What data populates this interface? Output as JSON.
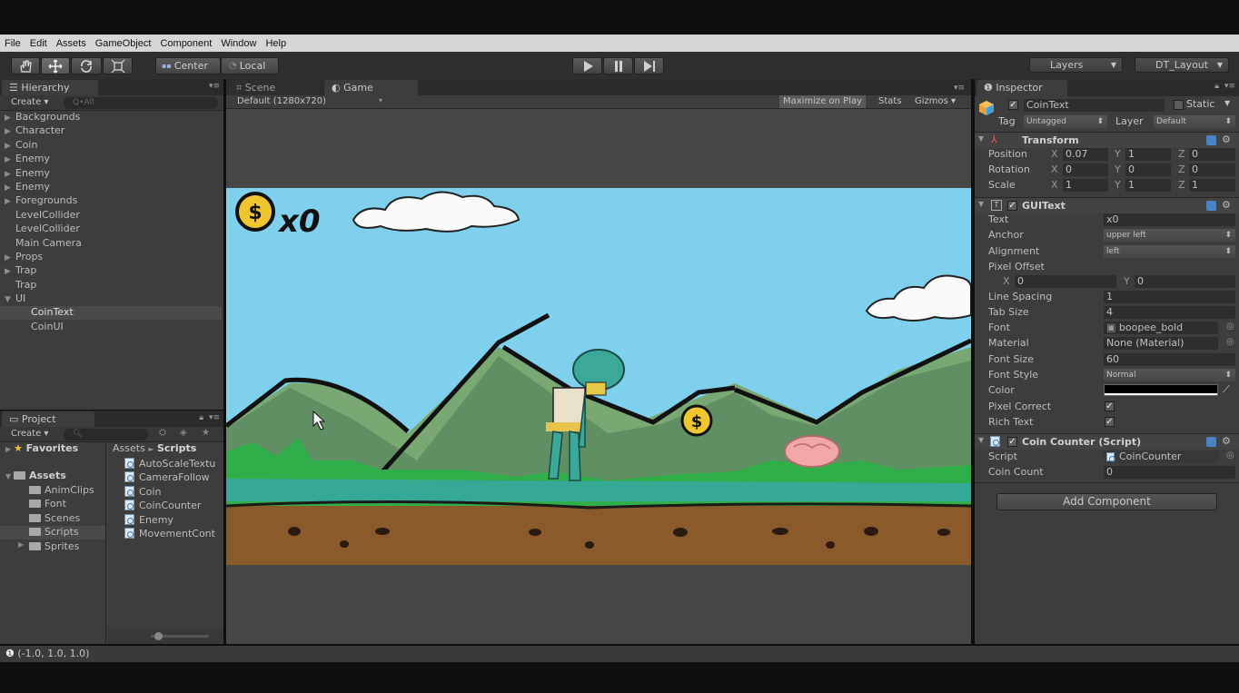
{
  "menubar": [
    "File",
    "Edit",
    "Assets",
    "GameObject",
    "Component",
    "Window",
    "Help"
  ],
  "toolbar": {
    "pivot_mode": "Center",
    "pivot_rotation": "Local",
    "layers": "Layers",
    "layout": "DT_Layout"
  },
  "hierarchy": {
    "tab": "Hierarchy",
    "create": "Create",
    "search_placeholder": "Q•All",
    "items": [
      {
        "label": "Backgrounds",
        "arrow": "▶"
      },
      {
        "label": "Character",
        "arrow": "▶"
      },
      {
        "label": "Coin",
        "arrow": "▶"
      },
      {
        "label": "Enemy",
        "arrow": "▶"
      },
      {
        "label": "Enemy",
        "arrow": "▶"
      },
      {
        "label": "Enemy",
        "arrow": "▶"
      },
      {
        "label": "Foregrounds",
        "arrow": "▶"
      },
      {
        "label": "LevelCollider",
        "arrow": ""
      },
      {
        "label": "LevelCollider",
        "arrow": ""
      },
      {
        "label": "Main Camera",
        "arrow": ""
      },
      {
        "label": "Props",
        "arrow": "▶"
      },
      {
        "label": "Trap",
        "arrow": "▶"
      },
      {
        "label": "Trap",
        "arrow": ""
      },
      {
        "label": "UI",
        "arrow": "▼"
      }
    ],
    "children": [
      "CoinText",
      "CoinUI"
    ]
  },
  "scene_tab": "Scene",
  "game": {
    "tab": "Game",
    "resolution": "Default (1280x720)",
    "maximize": "Maximize on Play",
    "stats": "Stats",
    "gizmos": "Gizmos",
    "coin_count_text": "x0",
    "coin_symbol": "$"
  },
  "project": {
    "tab": "Project",
    "create": "Create",
    "favorites": "Favorites",
    "assets": "Assets",
    "folders": [
      "AnimClips",
      "Font",
      "Scenes",
      "Scripts",
      "Sprites"
    ],
    "breadcrumb_root": "Assets",
    "breadcrumb_sep": "►",
    "breadcrumb_current": "Scripts",
    "files": [
      "AutoScaleTextu",
      "CameraFollow",
      "Coin",
      "CoinCounter",
      "Enemy",
      "MovementCont"
    ]
  },
  "inspector": {
    "tab": "Inspector",
    "object_name": "CoinText",
    "static": "Static",
    "tag_label": "Tag",
    "tag_value": "Untagged",
    "layer_label": "Layer",
    "layer_value": "Default",
    "transform": {
      "title": "Transform",
      "position_label": "Position",
      "position": {
        "x": "0.07",
        "y": "1",
        "z": "0"
      },
      "rotation_label": "Rotation",
      "rotation": {
        "x": "0",
        "y": "0",
        "z": "0"
      },
      "scale_label": "Scale",
      "scale": {
        "x": "1",
        "y": "1",
        "z": "1"
      }
    },
    "guitext": {
      "title": "GUIText",
      "text_label": "Text",
      "text": "x0",
      "anchor_label": "Anchor",
      "anchor": "upper left",
      "alignment_label": "Alignment",
      "alignment": "left",
      "pixel_offset_label": "Pixel Offset",
      "offset_x": "0",
      "offset_y": "0",
      "line_spacing_label": "Line Spacing",
      "line_spacing": "1",
      "tab_size_label": "Tab Size",
      "tab_size": "4",
      "font_label": "Font",
      "font": "boopee_bold",
      "material_label": "Material",
      "material": "None (Material)",
      "font_size_label": "Font Size",
      "font_size": "60",
      "font_style_label": "Font Style",
      "font_style": "Normal",
      "color_label": "Color",
      "color": "#000000",
      "pixel_correct_label": "Pixel Correct",
      "rich_text_label": "Rich Text"
    },
    "coin_counter": {
      "title": "Coin Counter (Script)",
      "script_label": "Script",
      "script": "CoinCounter",
      "coin_count_label": "Coin Count",
      "coin_count": "0"
    },
    "add_component": "Add Component"
  },
  "status": "(-1.0, 1.0, 1.0)"
}
